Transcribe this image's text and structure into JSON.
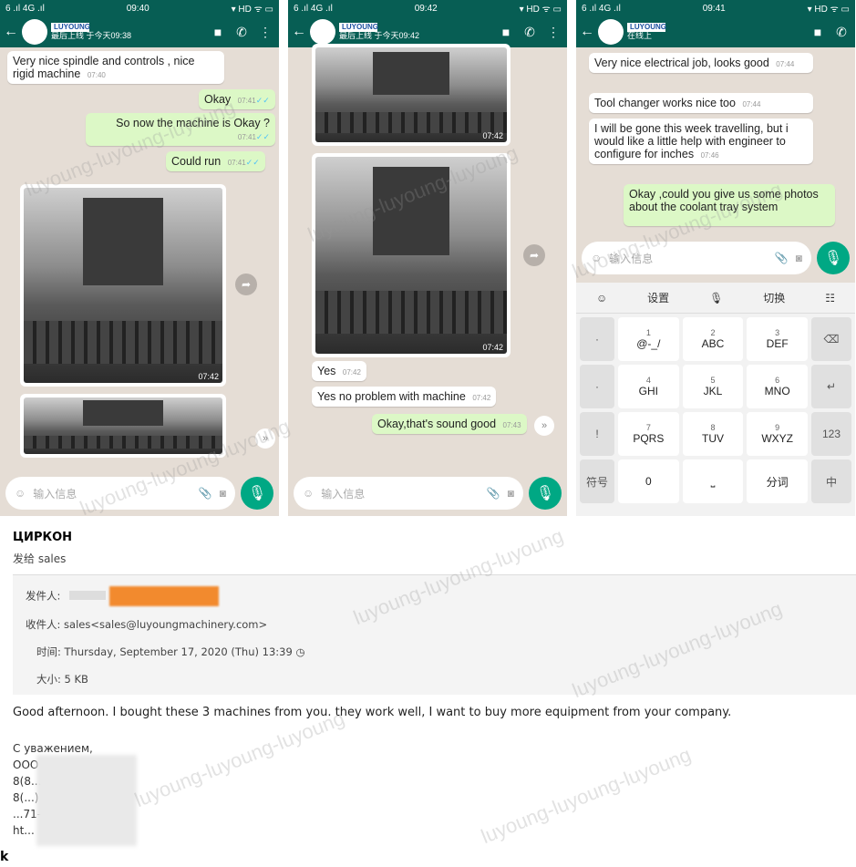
{
  "phone1": {
    "status": {
      "signal": "6 .ıl 4G .ıl",
      "time": "09:40",
      "icons": "▾ HD ᯤ ▭"
    },
    "header": {
      "logo": "LUYOUNG",
      "last_seen": "最后上线 于今天09:38"
    },
    "messages": [
      {
        "text": "Very nice spindle and controls , nice rigid machine",
        "time": "07:40",
        "dir": "in"
      },
      {
        "text": "Okay",
        "time": "07:41",
        "dir": "out"
      },
      {
        "text": "So now the machine is Okay ?",
        "time": "07:41",
        "dir": "out"
      },
      {
        "text": "Could run",
        "time": "07:41",
        "dir": "out"
      }
    ],
    "photo_time": "07:42",
    "input_placeholder": "输入信息"
  },
  "phone2": {
    "status": {
      "signal": "6 .ıl 4G .ıl",
      "time": "09:42",
      "icons": "▾ HD ᯤ ▭"
    },
    "header": {
      "logo": "LUYOUNG",
      "last_seen": "最后上线 于今天09:42"
    },
    "photo_time1": "07:42",
    "photo_time2": "07:42",
    "messages": [
      {
        "text": "Yes",
        "time": "07:42",
        "dir": "in"
      },
      {
        "text": "Yes no problem with machine",
        "time": "07:42",
        "dir": "in"
      },
      {
        "text": "Okay,that's sound good",
        "time": "07:43",
        "dir": "out"
      }
    ],
    "input_placeholder": "输入信息"
  },
  "phone3": {
    "status": {
      "signal": "6 .ıl 4G .ıl",
      "time": "09:41",
      "icons": "▾ HD ᯤ ▭"
    },
    "header": {
      "logo": "LUYOUNG",
      "last_seen": "在线上"
    },
    "messages": [
      {
        "text": "Very nice electrical job, looks good",
        "time": "07:44",
        "dir": "in"
      },
      {
        "text": "Tool changer works nice too",
        "time": "07:44",
        "dir": "in"
      },
      {
        "text": "I will be gone this week travelling, but i would like a little help with engineer to configure for inches",
        "time": "07:46",
        "dir": "in"
      },
      {
        "text": "Okay ,could you give us some photos about the coolant tray system",
        "time": "",
        "dir": "out"
      }
    ],
    "input_placeholder": "输入信息",
    "keyboard": {
      "top": [
        "☺",
        "设置",
        "🎙",
        "切换",
        "☷"
      ],
      "side": [
        "·",
        "·",
        "?",
        "!"
      ],
      "rows": [
        [
          {
            "n": "1",
            "l": "@-_/"
          },
          {
            "n": "2",
            "l": "ABC"
          },
          {
            "n": "3",
            "l": "DEF"
          }
        ],
        [
          {
            "n": "4",
            "l": "GHI"
          },
          {
            "n": "5",
            "l": "JKL"
          },
          {
            "n": "6",
            "l": "MNO"
          }
        ],
        [
          {
            "n": "7",
            "l": "PQRS"
          },
          {
            "n": "8",
            "l": "TUV"
          },
          {
            "n": "9",
            "l": "WXYZ"
          }
        ]
      ],
      "right": [
        "⌫",
        "↵",
        "123",
        "中"
      ],
      "bottom": [
        "符号",
        "0",
        "⎵",
        "分词"
      ]
    }
  },
  "email": {
    "sender": "ЦИРКОН",
    "to_line": "发给 sales",
    "from_label": "发件人:",
    "recipient_label": "收件人:",
    "recipient": "sales<sales@luyoungmachinery.com>",
    "time_label": "时间:",
    "time": "Thursday, September 17, 2020 (Thu) 13:39",
    "size_label": "大小:",
    "size": "5 KB",
    "body": "Good afternoon. I bought these 3 machines from you. they work well, I want to buy more equipment from your company.",
    "signature": [
      "С уважением,",
      "ООО \"ЦИРКОН\"",
      "8(8...",
      "8(...) ...71-7...",
      "...71-70",
      "ht..."
    ],
    "footer_char": "k"
  },
  "watermark": "luyoung-luyoung-luyoung",
  "colors": {
    "header": "#075e54",
    "out_bubble": "#dcf8c6",
    "chat_bg": "#e5ddd5",
    "mic": "#00a884",
    "redaction": "#f28a2e"
  }
}
